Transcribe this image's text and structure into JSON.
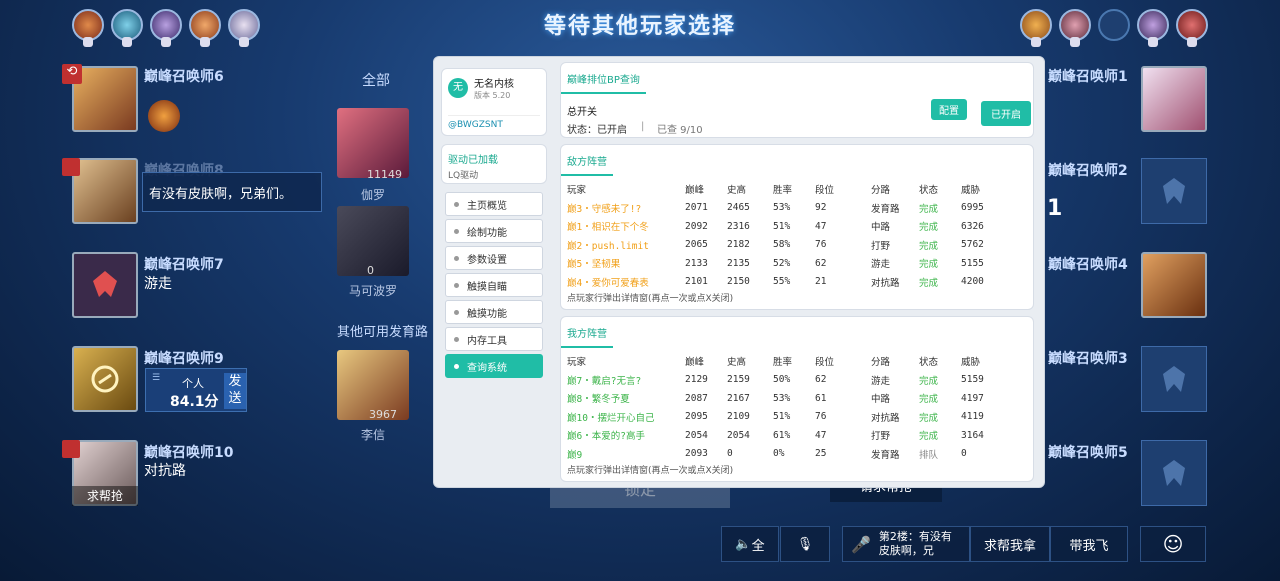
{
  "header": {
    "title": "等待其他玩家选择"
  },
  "left_players": [
    {
      "name": "巅峰召唤师6",
      "sub": ""
    },
    {
      "name": "巅峰召唤师8",
      "sub": "",
      "chat": "有没有皮肤啊，兄弟们。"
    },
    {
      "name": "巅峰召唤师7",
      "sub": "游走"
    },
    {
      "name": "巅峰召唤师9",
      "sub": "",
      "score_label": "个人",
      "score": "84.1分",
      "send": "发送"
    },
    {
      "name": "巅峰召唤师10",
      "sub": "对抗路",
      "help": "求帮抢"
    }
  ],
  "right_players": [
    {
      "name": "巅峰召唤师1"
    },
    {
      "name": "巅峰召唤师2"
    },
    {
      "name": "巅峰召唤师4"
    },
    {
      "name": "巅峰召唤师3"
    },
    {
      "name": "巅峰召唤师5"
    }
  ],
  "middle": {
    "tab_all": "全部",
    "other_label": "其他可用发育路",
    "heroes": [
      {
        "name": "伽罗",
        "count": "11149"
      },
      {
        "name": "马可波罗",
        "count": "0"
      },
      {
        "name": "李信",
        "count": "3967"
      }
    ],
    "right_num": "1"
  },
  "overlay": {
    "brand": {
      "logo": "无",
      "name": "无名内核",
      "version": "版本 5.20",
      "id": "@BWGZSNT"
    },
    "driver": {
      "status": "驱动已加载",
      "name": "LQ驱动"
    },
    "menu": [
      "主页概览",
      "绘制功能",
      "参数设置",
      "触摸自瞄",
      "触摸功能",
      "内存工具",
      "查询系统"
    ],
    "bp": {
      "title": "巅峰排位BP查询",
      "switch_label": "总开关",
      "status": "状态：已开启",
      "checked": "已查 9/10",
      "config_btn": "配置",
      "enabled_btn": "已开启"
    },
    "headers": [
      "玩家",
      "巅峰",
      "史高",
      "胜率",
      "段位",
      "分路",
      "状态",
      "威胁"
    ],
    "enemy": {
      "title": "敌方阵营",
      "rows": [
        [
          "巅3・守感未了!?",
          "2071",
          "2465",
          "53%",
          "92",
          "发育路",
          "完成",
          "6995"
        ],
        [
          "巅1・相识在下个冬",
          "2092",
          "2316",
          "51%",
          "47",
          "中路",
          "完成",
          "6326"
        ],
        [
          "巅2・push.limit",
          "2065",
          "2182",
          "58%",
          "76",
          "打野",
          "完成",
          "5762"
        ],
        [
          "巅5・坚韧果",
          "2133",
          "2135",
          "52%",
          "62",
          "游走",
          "完成",
          "5155"
        ],
        [
          "巅4・爱你可爱春表",
          "2101",
          "2150",
          "55%",
          "21",
          "对抗路",
          "完成",
          "4200"
        ]
      ],
      "hint": "点玩家行弹出详情窗(再点一次或点X关闭)"
    },
    "ally": {
      "title": "我方阵营",
      "rows": [
        [
          "巅7・戴启?无言?",
          "2129",
          "2159",
          "50%",
          "62",
          "游走",
          "完成",
          "5159"
        ],
        [
          "巅8・繁冬予夏",
          "2087",
          "2167",
          "53%",
          "61",
          "中路",
          "完成",
          "4197"
        ],
        [
          "巅10・摆烂开心自己",
          "2095",
          "2109",
          "51%",
          "76",
          "对抗路",
          "完成",
          "4119"
        ],
        [
          "巅6・本爱的?高手",
          "2054",
          "2054",
          "61%",
          "47",
          "打野",
          "完成",
          "3164"
        ],
        [
          "巅9",
          "2093",
          "0",
          "0%",
          "25",
          "发育路",
          "排队",
          "0"
        ]
      ],
      "hint": "点玩家行弹出详情窗(再点一次或点X关闭)"
    }
  },
  "bottom": {
    "lock_btn": "锁定",
    "help_btn": "请求帮抢",
    "speaker": "全",
    "chat_preview": "第2楼：有没有皮肤啊，兄",
    "ask_take": "求帮我拿",
    "carry_me": "带我飞"
  },
  "colors": {
    "accent": "#20bda6",
    "enemy_name": "#f1a01a",
    "ally_name": "#3cb44a"
  }
}
